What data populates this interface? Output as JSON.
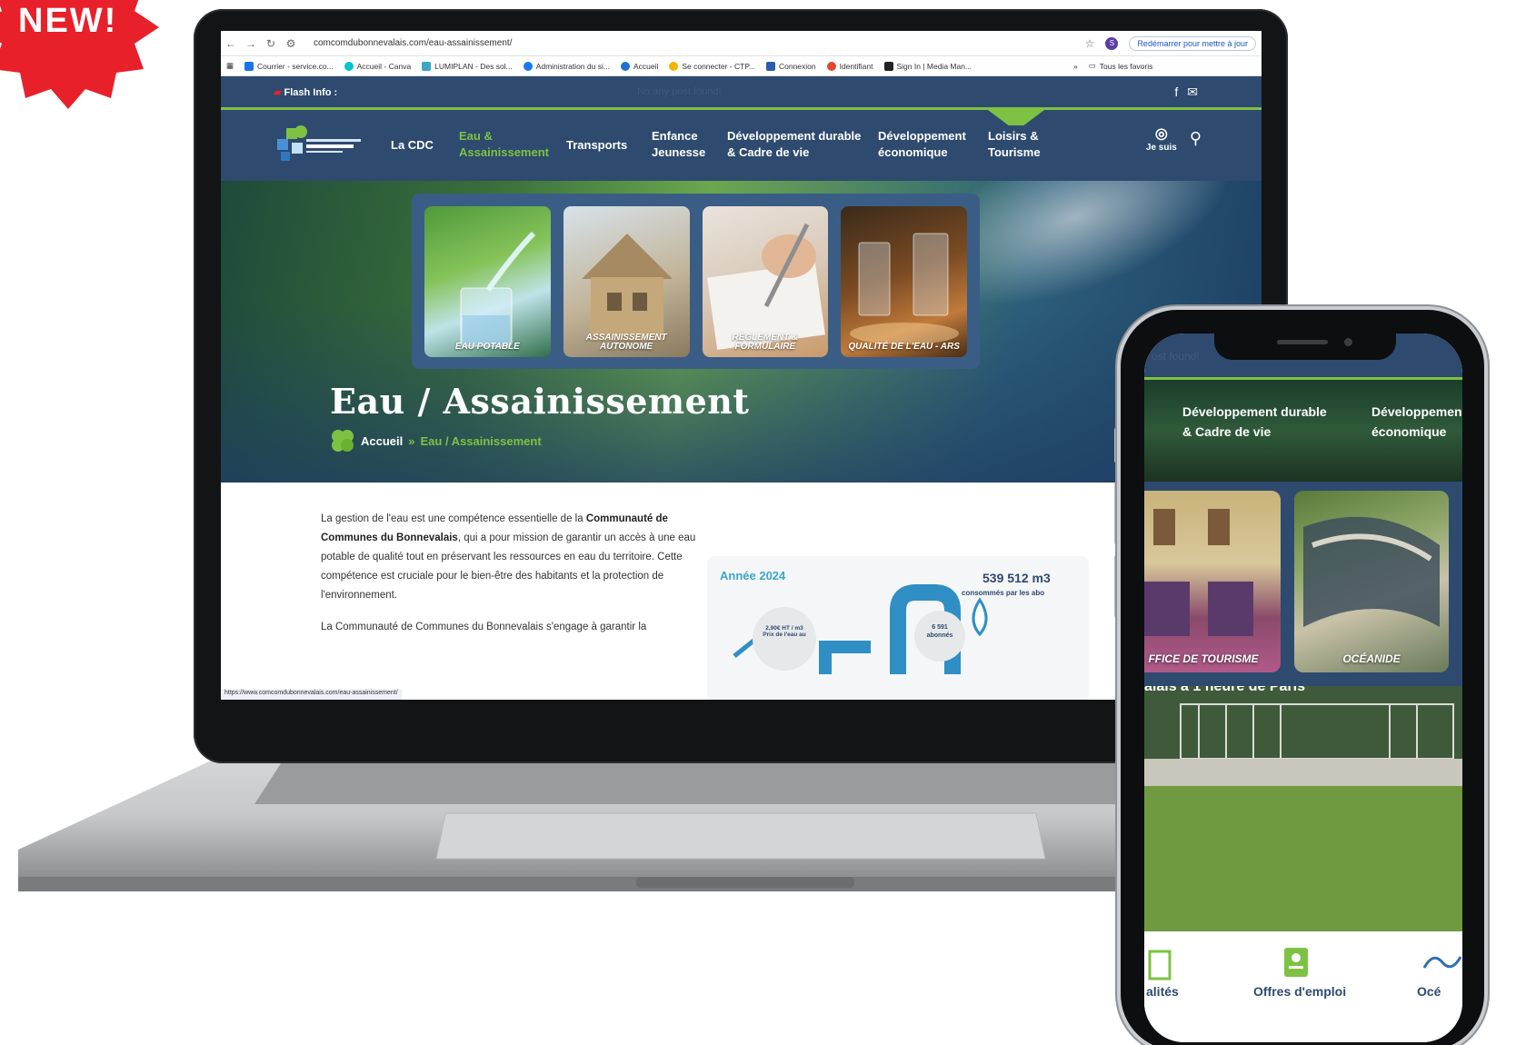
{
  "badge": {
    "text": "NEW!"
  },
  "browser": {
    "url": "comcomdubonnevalais.com/eau-assainissement/",
    "profile_initial": "S",
    "restart_label": "Redémarrer pour mettre à jour",
    "bookmarks": [
      "Courrier - service.co...",
      "Accueil - Canva",
      "LUMIPLAN - Des sol...",
      "Administration du si...",
      "Accueil",
      "Se connecter - CTP...",
      "Connexion",
      "Identifiant",
      "Sign In | Media Man..."
    ],
    "bookmarks_more": "»",
    "all_bookmarks": "Tous les favoris",
    "status_url": "https://www.comcomdubonnevalais.com/eau-assainissement/"
  },
  "site": {
    "flash_label": "Flash Info :",
    "flash_ticker": "No any post found!",
    "nav": [
      {
        "label": "La CDC"
      },
      {
        "label": "Eau &\nAssainissement"
      },
      {
        "label": "Transports"
      },
      {
        "label": "Enfance\nJeunesse"
      },
      {
        "label": "Développement durable\n& Cadre de vie"
      },
      {
        "label": "Développement\néconomique"
      },
      {
        "label": "Loisirs &\nTourisme"
      }
    ],
    "jesuis": "Je suis",
    "cards": [
      {
        "label": "EAU POTABLE"
      },
      {
        "label": "ASSAINISSEMENT\nAUTONOME"
      },
      {
        "label": "RÈGLEMENT &\nFORMULAIRE"
      },
      {
        "label": "QUALITÉ DE L'EAU - ARS"
      }
    ],
    "page_title": "Eau / Assainissement",
    "breadcrumb_home": "Accueil",
    "breadcrumb_sep": "»",
    "breadcrumb_current": "Eau / Assainissement",
    "intro_1": "La gestion de l'eau est une compétence essentielle de la ",
    "intro_bold": "Communauté de Communes du Bonnevalais",
    "intro_2": ", qui a pour mission de garantir un accès à une eau potable de qualité tout en préservant les ressources en eau du territoire. Cette compétence est cruciale pour le bien-être des habitants et la protection de l'environnement.",
    "para_2": "La Communauté de Communes du Bonnevalais s'engage à garantir la",
    "info": {
      "year": "Année 2024",
      "consumption": "539 512 m3",
      "consumption_label": "consommés par les abo",
      "price_value": "2,90€ HT / m3",
      "price_label": "Prix de l'eau au",
      "subscribers_value": "6 591",
      "subscribers_label": "abonnés"
    }
  },
  "phone": {
    "ticker": "ost found!",
    "nav": [
      {
        "label": "Développement durable\n& Cadre de vie"
      },
      {
        "label": "Développement\néconomique"
      }
    ],
    "cards": [
      {
        "label": "FFICE DE TOURISME"
      },
      {
        "label": "OCÉANIDE"
      }
    ],
    "photo_caption": "alais à 1 heure de Paris",
    "bottom": [
      {
        "label": "alités"
      },
      {
        "label": "Offres d'emploi"
      },
      {
        "label": "Océ"
      }
    ]
  },
  "colors": {
    "navy": "#2e4a6e",
    "green": "#7dc242",
    "badge_red": "#e8202a"
  }
}
